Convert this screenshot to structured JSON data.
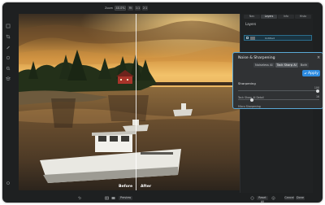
{
  "toolbar": {
    "zoom_label": "Zoom",
    "zoom_value": "40.0%",
    "zoom_preset_1": "Fit",
    "zoom_preset_2": "1:1",
    "zoom_preset_3": "2:1"
  },
  "canvas": {
    "before_label": "Before",
    "after_label": "After"
  },
  "layers_panel": {
    "tabs": [
      "Nav",
      "Layers",
      "Info",
      "Histo"
    ],
    "active_tab_index": 1,
    "title": "Layers",
    "selected_layer_name": "Untitled"
  },
  "dialog": {
    "title": "Noise & Sharpening",
    "modes": [
      "Noiseless AI",
      "Tack Sharp AI",
      "Both"
    ],
    "active_mode_index": 1,
    "apply_label": "Apply",
    "section_label": "Sharpening",
    "sliders": [
      {
        "name": "Tack Sharp AI Detail",
        "value": "100",
        "level": 1.0
      },
      {
        "name": "Micro Sharpening",
        "value": "16",
        "level": 0.16
      }
    ]
  },
  "bottom_bar": {
    "preview_label": "Preview",
    "reset_label": "Reset All",
    "cancel_label": "Cancel",
    "done_label": "Done"
  },
  "colors": {
    "accent": "#2d8be0",
    "dialog_border": "#5aa8d6",
    "window_bg": "#1e2021"
  },
  "icons": [
    "eye-icon",
    "crop-icon",
    "brush-icon",
    "hand-icon",
    "layers-icon",
    "split-view-icon",
    "compare-icon",
    "settings-icon"
  ]
}
